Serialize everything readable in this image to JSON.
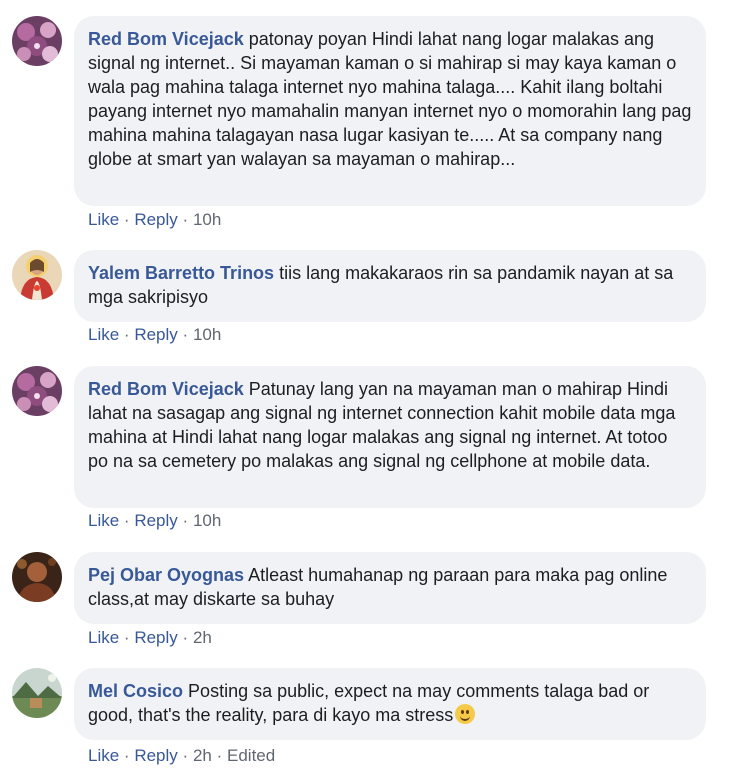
{
  "comments": [
    {
      "author": "Red Bom Vicejack",
      "text": "patonay poyan Hindi lahat nang logar malakas ang signal ng internet.. Si mayaman kaman o si mahirap si may kaya kaman o wala pag mahina talaga internet nyo mahina talaga.... Kahit ilang boltahi payang internet nyo mamahalin manyan internet nyo o momorahin lang pag mahina mahina talagayan nasa lugar kasiyan te..... At sa company nang globe at smart yan walayan sa mayaman o mahirap...",
      "like": "Like",
      "reply": "Reply",
      "time": "10h",
      "edited": "",
      "avatar_icon": "purple-floral-avatar-icon"
    },
    {
      "author": "Yalem Barretto Trinos",
      "text": "tiis lang makakaraos rin sa pandamik nayan at sa mga sakripisyo",
      "like": "Like",
      "reply": "Reply",
      "time": "10h",
      "edited": "",
      "avatar_icon": "sacred-heart-avatar-icon"
    },
    {
      "author": "Red Bom Vicejack",
      "text": "Patunay lang yan na mayaman man o mahirap Hindi lahat na sasagap ang signal ng internet connection kahit mobile data mga mahina at Hindi lahat nang logar malakas ang signal ng internet. At totoo po na sa cemetery po malakas ang signal ng cellphone at mobile data.",
      "like": "Like",
      "reply": "Reply",
      "time": "10h",
      "edited": "",
      "avatar_icon": "purple-floral-avatar-icon"
    },
    {
      "author": "Pej Obar Oyognas",
      "text": "Atleast humahanap ng paraan para maka pag online class,at may diskarte sa buhay",
      "like": "Like",
      "reply": "Reply",
      "time": "2h",
      "edited": "",
      "avatar_icon": "dark-portrait-avatar-icon"
    },
    {
      "author": "Mel Cosico",
      "text": "Posting sa public, expect na may comments talaga bad or good, that's the reality, para di kayo ma stress",
      "like": "Like",
      "reply": "Reply",
      "time": "2h",
      "edited": "Edited",
      "avatar_icon": "landscape-avatar-icon",
      "emoji": "smiling-face-emoji"
    }
  ],
  "separator": "·"
}
